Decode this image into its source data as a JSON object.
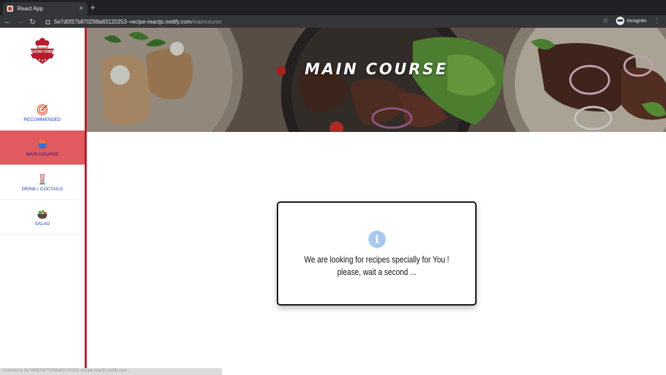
{
  "browser": {
    "tab_title": "React App",
    "tab_close": "×",
    "new_tab": "+",
    "url_host": "5e7d0f37b870298a83120253--recipe-reactjs.netlify.com",
    "url_path": "/maincourse",
    "incognito_label": "Incognito",
    "status_text": "Connect to 5e7d0f37b870298a83120253--recipe-reactjs.netlify.com..."
  },
  "sidebar": {
    "logo_text": "GOOD CHEF",
    "items": [
      {
        "label": "RECOMMENDED",
        "icon": "target-icon",
        "active": false
      },
      {
        "label": "MAIN COURSE",
        "icon": "bowl-icon",
        "active": true
      },
      {
        "label": "DRINK / COCTAILS",
        "icon": "blender-icon",
        "active": false
      },
      {
        "label": "SALAD",
        "icon": "salad-icon",
        "active": false
      }
    ]
  },
  "hero": {
    "title": "MAIN COURSE"
  },
  "modal": {
    "icon": "info-icon",
    "message": "We are looking for recipes specially for You ! please, wait a second ..."
  },
  "colors": {
    "accent": "#b71c2e",
    "active_item": "#e05a5f",
    "link": "#1a37c9"
  }
}
